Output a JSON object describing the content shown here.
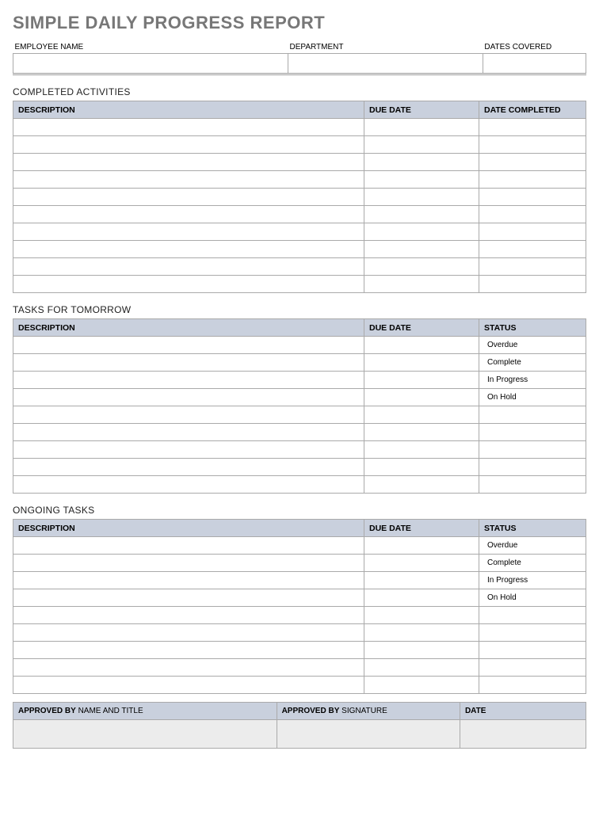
{
  "title": "SIMPLE DAILY PROGRESS REPORT",
  "header": {
    "employee_label": "EMPLOYEE NAME",
    "department_label": "DEPARTMENT",
    "dates_label": "DATES COVERED",
    "employee_value": "",
    "department_value": "",
    "dates_value": ""
  },
  "sections": {
    "completed": {
      "title": "COMPLETED ACTIVITIES",
      "columns": {
        "desc": "DESCRIPTION",
        "due": "DUE DATE",
        "done": "DATE COMPLETED"
      },
      "rows": [
        "",
        "",
        "",
        "",
        "",
        "",
        "",
        "",
        "",
        ""
      ]
    },
    "tomorrow": {
      "title": "TASKS FOR TOMORROW",
      "columns": {
        "desc": "DESCRIPTION",
        "due": "DUE DATE",
        "status": "STATUS"
      },
      "status_values": [
        "Overdue",
        "Complete",
        "In Progress",
        "On Hold"
      ],
      "rows_count": 9
    },
    "ongoing": {
      "title": "ONGOING TASKS",
      "columns": {
        "desc": "DESCRIPTION",
        "due": "DUE DATE",
        "status": "STATUS"
      },
      "status_values": [
        "Overdue",
        "Complete",
        "In Progress",
        "On Hold"
      ],
      "rows_count": 9
    }
  },
  "approval": {
    "approved_by_bold": "APPROVED BY",
    "name_title": " NAME AND TITLE",
    "signature": " SIGNATURE",
    "date_label": "DATE"
  },
  "colors": {
    "header_bg": "#c9d0dd",
    "overdue": "#f4c851",
    "complete": "#18b83a",
    "inprogress": "#8bc34a",
    "onhold": "#cfcfcf"
  }
}
